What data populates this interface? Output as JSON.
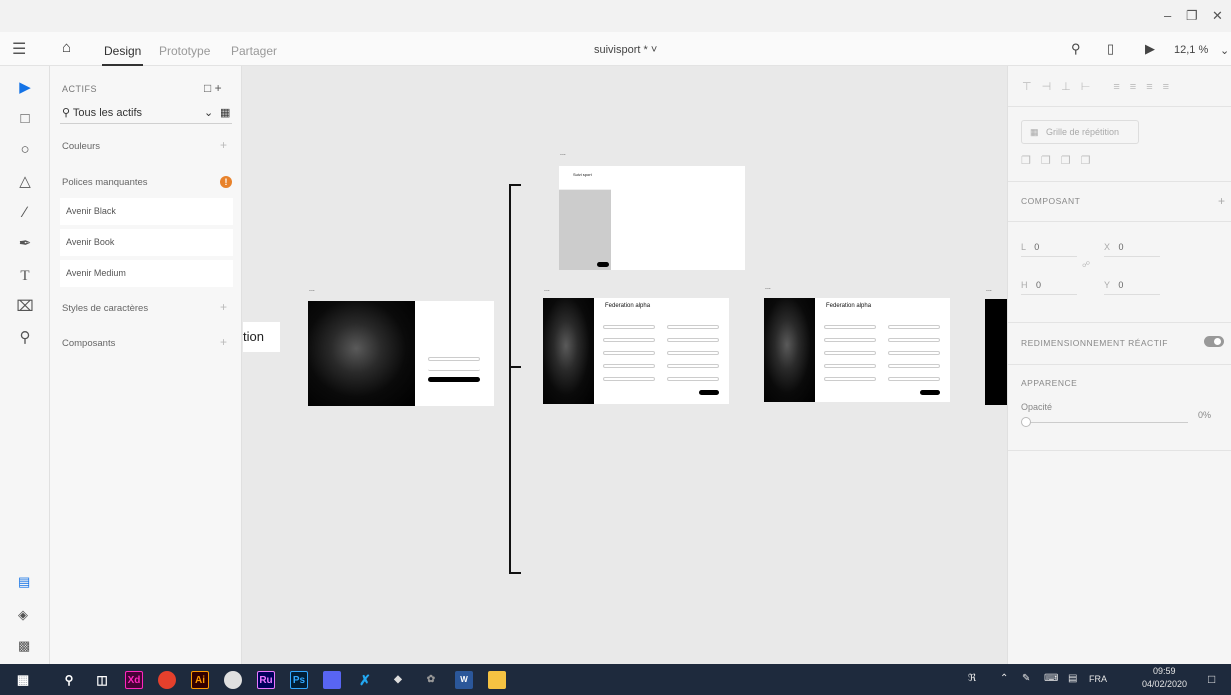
{
  "window": {
    "min_icon": "minimize-icon",
    "max_icon": "maximize-icon",
    "close_icon": "close-icon"
  },
  "nav": {
    "tabs": [
      "Design",
      "Prototype",
      "Partager"
    ],
    "active_tab": "Design",
    "doc_title": "suivisport * ˅",
    "zoom": "12,1 %"
  },
  "assets": {
    "header": "ACTIFS",
    "search_value": "Tous les actifs",
    "sections": {
      "colors": "Couleurs",
      "missing_fonts": "Polices manquantes",
      "char_styles": "Styles de caractères",
      "components": "Composants"
    },
    "missing_fonts": [
      "Avenir Black",
      "Avenir Book",
      "Avenir Medium"
    ],
    "warning_glyph": "!"
  },
  "canvas": {
    "partial_label": "tion",
    "frame_label": "...",
    "artboards": [
      {
        "title": "",
        "subtitle": "",
        "button": ""
      },
      {
        "title": "Federation alpha",
        "subtitle": "",
        "button": ""
      },
      {
        "title": "Federation alpha",
        "subtitle": "",
        "button": ""
      },
      {
        "title": "Suivi sport",
        "subtitle": "",
        "button": ""
      }
    ]
  },
  "props": {
    "repeat_grid": "Grille de répétition",
    "component": "COMPOSANT",
    "l_label": "L",
    "l_value": "0",
    "x_label": "X",
    "x_value": "0",
    "h_label": "H",
    "h_value": "0",
    "y_label": "Y",
    "y_value": "0",
    "responsive": "REDIMENSIONNEMENT RÉACTIF",
    "appearance": "APPARENCE",
    "opacity_label": "Opacité",
    "opacity_value": "0%"
  },
  "taskbar": {
    "language": "FRA",
    "time": "09:59",
    "date": "04/02/2020",
    "apps": [
      {
        "name": "Xd",
        "color": "#ff26be",
        "bg": "#470137"
      },
      {
        "name": "Ai",
        "color": "#ff9a00",
        "bg": "#330000"
      },
      {
        "name": "Ru",
        "color": "#ea77ff",
        "bg": "#00005b"
      },
      {
        "name": "Ps",
        "color": "#31a8ff",
        "bg": "#001e36"
      }
    ]
  }
}
